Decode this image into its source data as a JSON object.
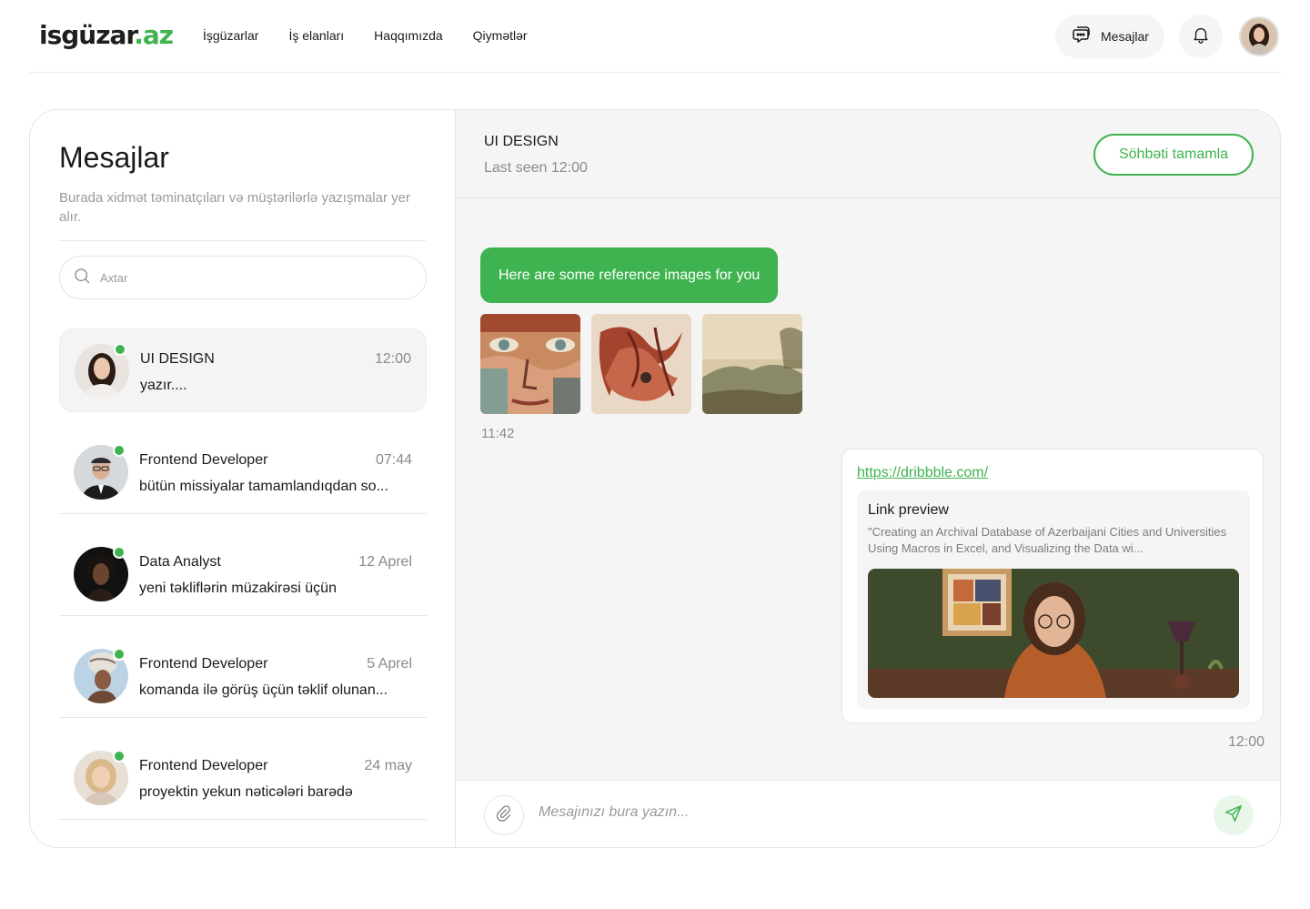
{
  "header": {
    "logo_main": "isgüzar",
    "logo_dot": ".",
    "logo_tld": "az",
    "nav": [
      "İşgüzarlar",
      "İş elanları",
      "Haqqımızda",
      "Qiymətlər"
    ],
    "messages_button": "Mesajlar"
  },
  "sidebar": {
    "title": "Mesajlar",
    "subtitle": "Burada xidmət təminatçıları və müştərilərlə yazışmalar yer alır.",
    "search_placeholder": "Axtar",
    "conversations": [
      {
        "name": "UI DESIGN",
        "time": "12:00",
        "preview": "yazır....",
        "online": true,
        "active": true
      },
      {
        "name": "Frontend Developer",
        "time": "07:44",
        "preview": "bütün missiyalar tamamlandıqdan so...",
        "online": true
      },
      {
        "name": "Data Analyst",
        "time": "12 Aprel",
        "preview": "yeni təkliflərin müzakirəsi üçün",
        "online": true
      },
      {
        "name": "Frontend Developer",
        "time": "5 Aprel",
        "preview": "komanda ilə görüş üçün təklif olunan...",
        "online": true
      },
      {
        "name": "Frontend Developer",
        "time": "24 may",
        "preview": "proyektin yekun nəticələri barədə",
        "online": true
      }
    ]
  },
  "chat": {
    "title": "UI DESIGN",
    "last_seen": "Last seen 12:00",
    "end_button": "Söhbəti tamamla",
    "messages": {
      "incoming_text": "Here are some reference images for you",
      "incoming_time": "11:42",
      "link_url": "https://dribbble.com/",
      "link_preview_title": "Link preview",
      "link_preview_desc": "\"Creating an Archival Database of Azerbaijani Cities and Universities Using Macros in Excel, and Visualizing the Data wi...",
      "outgoing_time": "12:00"
    },
    "composer_placeholder": "Mesajınızı bura yazın..."
  },
  "colors": {
    "accent": "#3fb34f",
    "panel_bg": "#f5f5f5",
    "muted_text": "#8a8a8a"
  },
  "icons": {
    "messages": "chat-bubbles-icon",
    "notifications": "bell-icon",
    "search": "search-icon",
    "attach": "paperclip-icon",
    "send": "send-icon"
  }
}
